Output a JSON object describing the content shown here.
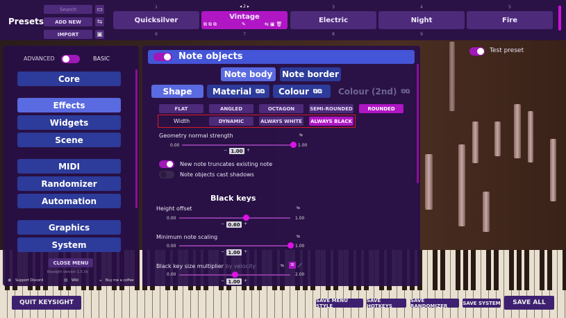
{
  "presets": {
    "title": "Presets",
    "search_placeholder": "Search",
    "add_new": "ADD NEW",
    "import": "IMPORT",
    "tiles_row1": [
      {
        "num": "1",
        "name": "Quicksilver"
      },
      {
        "num": "2",
        "name": "Vintage"
      },
      {
        "num": "3",
        "name": "Electric"
      },
      {
        "num": "4",
        "name": "Night"
      },
      {
        "num": "5",
        "name": "Fire"
      }
    ],
    "tiles_row2_nums": [
      "6",
      "7",
      "8",
      "9"
    ],
    "active_nav": "◂ 2 ▸"
  },
  "test_preset": "Test preset",
  "sidebar": {
    "advanced": "ADVANCED",
    "basic": "BASIC",
    "groups": [
      [
        "Core"
      ],
      [
        "Effects",
        "Widgets",
        "Scene"
      ],
      [
        "MIDI",
        "Randomizer",
        "Automation"
      ],
      [
        "Graphics",
        "System"
      ]
    ],
    "active_item": "Effects",
    "close_menu": "CLOSE MENU",
    "version": "Keysight version 1.5.3e",
    "support_discord": "Support Discord",
    "wiki": "Wiki",
    "buy_coffee": "Buy me a coffee"
  },
  "panel": {
    "title": "Note objects",
    "sub_tabs": [
      "Note body",
      "Note border"
    ],
    "tabs": [
      "Shape",
      "Material",
      "Colour",
      "Colour (2nd)"
    ],
    "shapes": [
      "FLAT",
      "ANGLED",
      "OCTAGON",
      "SEMI-ROUNDED",
      "ROUNDED"
    ],
    "active_shape": "ROUNDED",
    "width_label": "Width",
    "width_options": [
      "DYNAMIC",
      "ALWAYS WHITE",
      "ALWAYS BLACK"
    ],
    "active_width": "ALWAYS BLACK",
    "geom": {
      "label": "Geometry normal strength",
      "min": "0.00",
      "max": "1.00",
      "value": "1.00",
      "fill": 1.0
    },
    "toggle1": "New note truncates existing note",
    "toggle2": "Note objects cast shadows",
    "black_keys_title": "Black keys",
    "height_offset": {
      "label": "Height offset",
      "min": "0.00",
      "max": "1.00",
      "value": "0.60",
      "fill": 0.6
    },
    "min_scaling": {
      "label": "Minimum note scaling",
      "min": "0.00",
      "max": "1.00",
      "value": "1.00",
      "fill": 1.0
    },
    "size_mult": {
      "label": "Black key size multiplier",
      "suffix": "by velocity",
      "min": "0.00",
      "max": "2.00",
      "value": "1.00",
      "fill": 0.5
    }
  },
  "bottom": {
    "quit": "QUIT KEYSIGHT",
    "save_menu_style": "SAVE MENU STYLE",
    "save_hotkeys": "SAVE HOTKEYS",
    "save_randomizer": "SAVE RANDOMIZER",
    "save_system": "SAVE SYSTEM",
    "save_all": "SAVE ALL"
  },
  "colors": {
    "accent": "#b016c4",
    "nav": "#2d3b9a",
    "nav_active": "#5a6ae0",
    "header": "#4455d8",
    "highlight_box": "#e01828"
  }
}
